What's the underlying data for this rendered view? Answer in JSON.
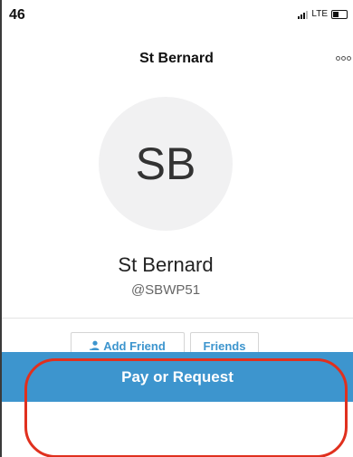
{
  "status_bar": {
    "time": "46",
    "network": "LTE",
    "battery_level": 0.45
  },
  "header": {
    "title": "St Bernard",
    "more_icon": "more-options-icon"
  },
  "profile": {
    "initials": "SB",
    "name": "St Bernard",
    "handle": "@SBWP51"
  },
  "actions": {
    "add_friend_label": "Add Friend",
    "friends_label": "Friends"
  },
  "primary_action": {
    "label": "Pay or Request"
  },
  "colors": {
    "accent": "#3d95ce",
    "highlight": "#e0301e"
  }
}
